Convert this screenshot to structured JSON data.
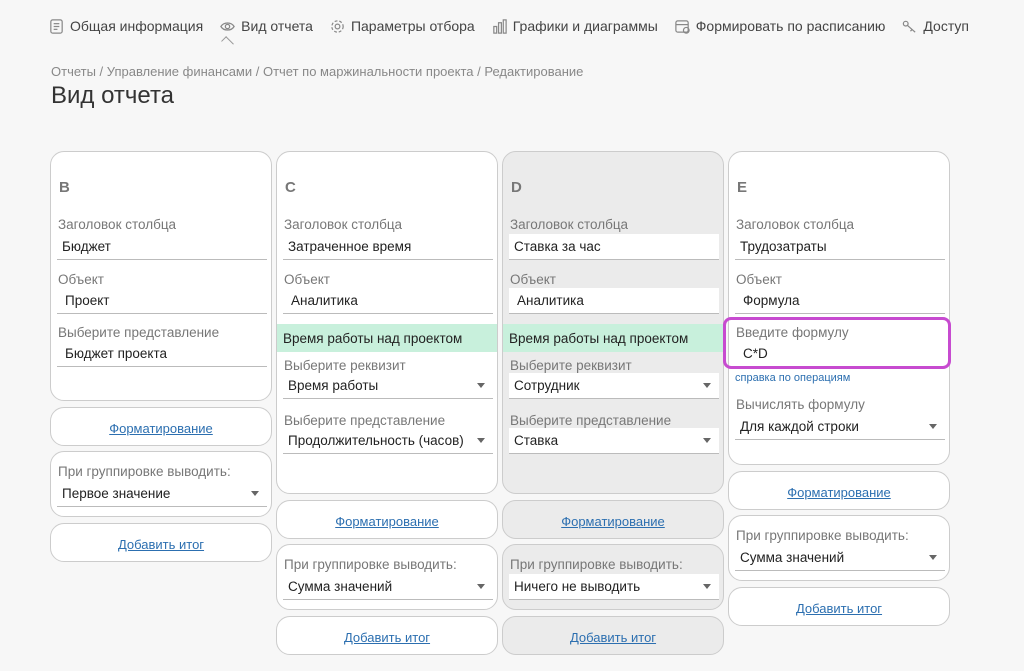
{
  "nav": {
    "items": [
      {
        "label": "Общая информация",
        "icon": "document-icon"
      },
      {
        "label": "Вид отчета",
        "icon": "eye-icon"
      },
      {
        "label": "Параметры отбора",
        "icon": "gear-icon"
      },
      {
        "label": "Графики и диаграммы",
        "icon": "chart-icon"
      },
      {
        "label": "Формировать по расписанию",
        "icon": "calendar-icon"
      },
      {
        "label": "Доступ",
        "icon": "key-icon"
      }
    ]
  },
  "breadcrumb": "Отчеты / Управление финансами / Отчет по маржинальности проекта / Редактирование",
  "title": "Вид отчета",
  "accent_color": "#c74bd0",
  "columns": {
    "b": {
      "letter": "B",
      "header_label": "Заголовок столбца",
      "header_value": "Бюджет",
      "object_label": "Объект",
      "object_value": "Проект",
      "view_label": "Выберите представление",
      "view_value": "Бюджет проекта",
      "format_link": "Форматирование",
      "group_label": "При группировке выводить:",
      "group_value": "Первое значение",
      "add_total": "Добавить итог"
    },
    "c": {
      "letter": "C",
      "header_label": "Заголовок столбца",
      "header_value": "Затраченное время",
      "object_label": "Объект",
      "object_value": "Аналитика",
      "analytic": "Время работы над проектом",
      "req_label": "Выберите реквизит",
      "req_value": "Время работы",
      "view_label": "Выберите представление",
      "view_value": "Продолжительность (часов)",
      "format_link": "Форматирование",
      "group_label": "При группировке выводить:",
      "group_value": "Сумма значений",
      "add_total": "Добавить итог"
    },
    "d": {
      "letter": "D",
      "header_label": "Заголовок столбца",
      "header_value": "Ставка за час",
      "object_label": "Объект",
      "object_value": "Аналитика",
      "analytic": "Время работы над проектом",
      "req_label": "Выберите реквизит",
      "req_value": "Сотрудник",
      "view_label": "Выберите представление",
      "view_value": "Ставка",
      "format_link": "Форматирование",
      "group_label": "При группировке выводить:",
      "group_value": "Ничего не выводить",
      "add_total": "Добавить итог"
    },
    "e": {
      "letter": "E",
      "header_label": "Заголовок столбца",
      "header_value": "Трудозатраты",
      "object_label": "Объект",
      "object_value": "Формула",
      "formula_label": "Введите формулу",
      "formula_value": "C*D",
      "help_link": "справка по операциям",
      "calc_label": "Вычислять формулу",
      "calc_value": "Для каждой строки",
      "format_link": "Форматирование",
      "group_label": "При группировке выводить:",
      "group_value": "Сумма значений",
      "add_total": "Добавить итог"
    }
  }
}
